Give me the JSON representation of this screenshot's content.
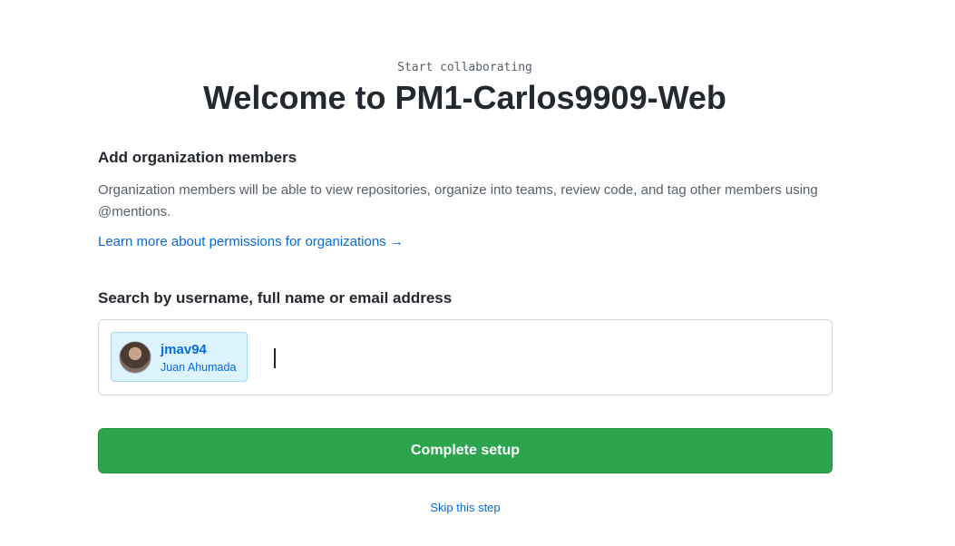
{
  "header": {
    "eyebrow": "Start collaborating",
    "title": "Welcome to PM1-Carlos9909-Web"
  },
  "section": {
    "title": "Add organization members",
    "description": "Organization members will be able to view repositories, organize into teams, review code, and tag other members using @mentions.",
    "learn_link": "Learn more about permissions for organizations →"
  },
  "search": {
    "label": "Search by username, full name or email address",
    "value": "",
    "selected_members": [
      {
        "username": "jmav94",
        "full_name": "Juan Ahumada"
      }
    ]
  },
  "actions": {
    "complete_label": "Complete setup",
    "skip_label": "Skip this step"
  },
  "colors": {
    "primary_button": "#2da44e",
    "link": "#0969da",
    "chip_background": "#ddf4ff"
  }
}
